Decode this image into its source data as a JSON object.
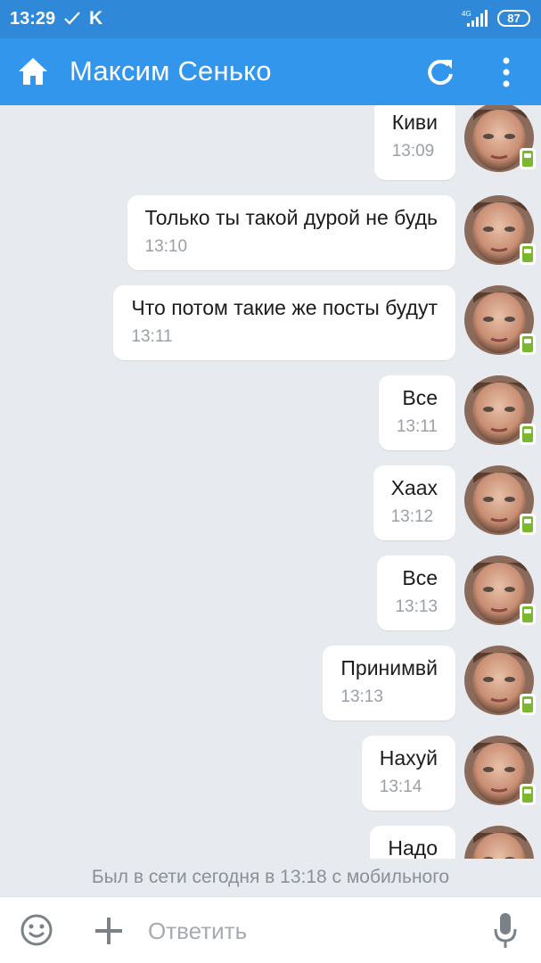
{
  "status_bar": {
    "time": "13:29",
    "app_letter": "K",
    "network": "4G",
    "battery": "87"
  },
  "header": {
    "title": "Максим Сенько",
    "icons": [
      "home-icon",
      "refresh-icon",
      "more-vert-icon"
    ]
  },
  "messages": [
    {
      "text": "Киви",
      "time": "13:09"
    },
    {
      "text": "Только ты такой дурой не будь",
      "time": "13:10"
    },
    {
      "text": "Что потом такие же посты будут",
      "time": "13:11"
    },
    {
      "text": "Все",
      "time": "13:11"
    },
    {
      "text": "Хаах",
      "time": "13:12"
    },
    {
      "text": "Все",
      "time": "13:13"
    },
    {
      "text": "Принимвй",
      "time": "13:13"
    },
    {
      "text": "Нахуй",
      "time": "13:14"
    },
    {
      "text": "Надо",
      "time": ""
    }
  ],
  "presence": "Был в сети сегодня в 13:18 с мобильного",
  "composer": {
    "placeholder": "Ответить",
    "icons": [
      "emoji-icon",
      "plus-icon",
      "microphone-icon"
    ]
  },
  "colors": {
    "status_bar": "#2f89d8",
    "app_bar": "#3196ec",
    "chat_background": "#e7eaee",
    "online_mobile_badge": "#7cb82f"
  }
}
